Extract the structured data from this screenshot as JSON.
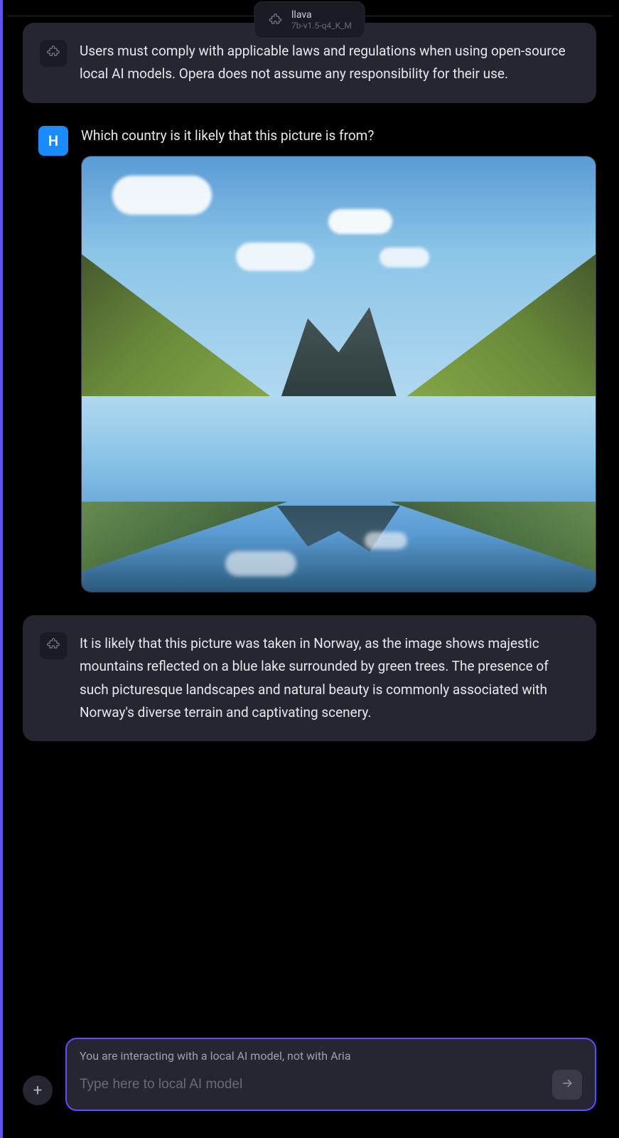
{
  "model_badge": {
    "name": "llava",
    "version": "7b-v1.5-q4_K_M",
    "icon": "puzzle-icon"
  },
  "messages": {
    "system_1": {
      "text": "Users must comply with applicable laws and regulations when using open-source local AI models. Opera does not assume any responsibility for their use.",
      "icon": "puzzle-icon"
    },
    "user_1": {
      "avatar_letter": "H",
      "text": "Which country is it likely that this picture is from?",
      "attached_image": "landscape-mountains-lake"
    },
    "system_2": {
      "text": "It is likely that this picture was taken in Norway, as the image shows majestic mountains reflected on a blue lake surrounded by green trees. The presence of such picturesque landscapes and natural beauty is commonly associated with Norway's diverse terrain and captivating scenery.",
      "icon": "puzzle-icon"
    }
  },
  "input": {
    "notice": "You are interacting with a local AI model, not with Aria",
    "placeholder": "Type here to local AI model",
    "value": "",
    "plus_icon": "plus-icon",
    "send_icon": "arrow-right-icon"
  },
  "colors": {
    "accent": "#5d4eff",
    "user_avatar": "#1a8cff",
    "bg_message": "#252631",
    "bg_page": "#000000"
  }
}
